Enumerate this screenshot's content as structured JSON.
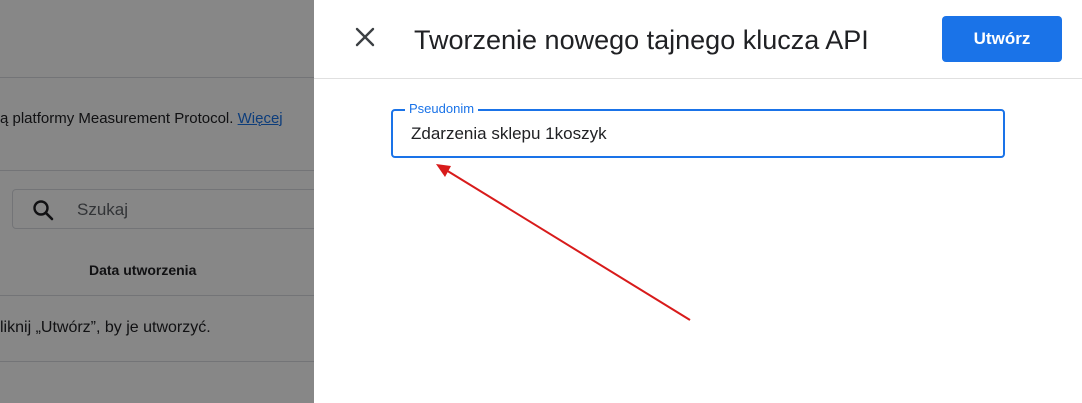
{
  "background": {
    "description_text": "ą platformy Measurement Protocol.",
    "description_link": "Więcej",
    "search": {
      "placeholder": "Szukaj",
      "icon": "search-icon"
    },
    "table": {
      "column_header": "Data utworzenia"
    },
    "empty_message": "liknij „Utwórz”, by je utworzyć."
  },
  "panel": {
    "close_icon": "close-icon",
    "title": "Tworzenie nowego tajnego klucza API",
    "create_button": "Utwórz",
    "field": {
      "label": "Pseudonim",
      "value": "Zdarzenia sklepu 1koszyk"
    }
  },
  "colors": {
    "accent": "#1a73e8",
    "annotation_arrow": "#d81b1b",
    "scrim": "rgba(0,0,0,0.47)"
  }
}
